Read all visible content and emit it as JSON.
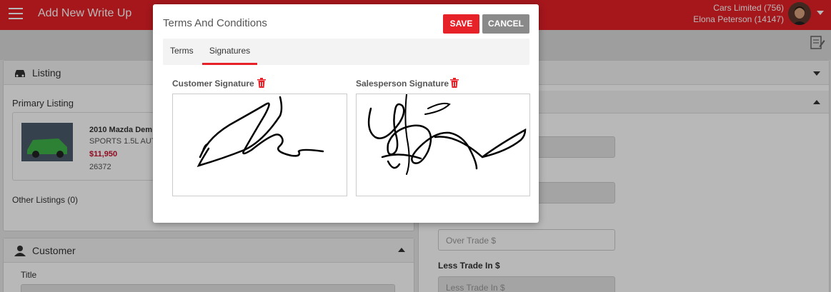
{
  "header": {
    "title": "Add New Write Up",
    "company": "Cars Limited (756)",
    "user": "Elona Peterson (14147)"
  },
  "background": {
    "listing_panel": {
      "title": "Listing",
      "primary_label": "Primary Listing",
      "vehicle_title": "2010 Mazda Dem",
      "vehicle_subtitle": "SPORTS 1.5L AUT",
      "price": "$11,950",
      "stock": "26372",
      "other_listings": "Other Listings (0)"
    },
    "customer_panel": {
      "title": "Customer",
      "title_label": "Title"
    },
    "right_panel": {
      "over_trade_placeholder": "Over Trade $",
      "less_trade_label": "Less Trade In $",
      "less_trade_placeholder": "Less Trade In $"
    }
  },
  "modal": {
    "title": "Terms And Conditions",
    "save_label": "SAVE",
    "cancel_label": "CANCEL",
    "tabs": [
      {
        "label": "Terms",
        "active": false
      },
      {
        "label": "Signatures",
        "active": true
      }
    ],
    "customer_signature_label": "Customer Signature",
    "salesperson_signature_label": "Salesperson Signature"
  },
  "colors": {
    "brand": "#e62127",
    "price": "#c8102e",
    "cancel": "#8a8a8a"
  },
  "icons": [
    "hamburger-icon",
    "avatar",
    "notes-icon",
    "car-icon",
    "user-icon",
    "trash-icon"
  ]
}
